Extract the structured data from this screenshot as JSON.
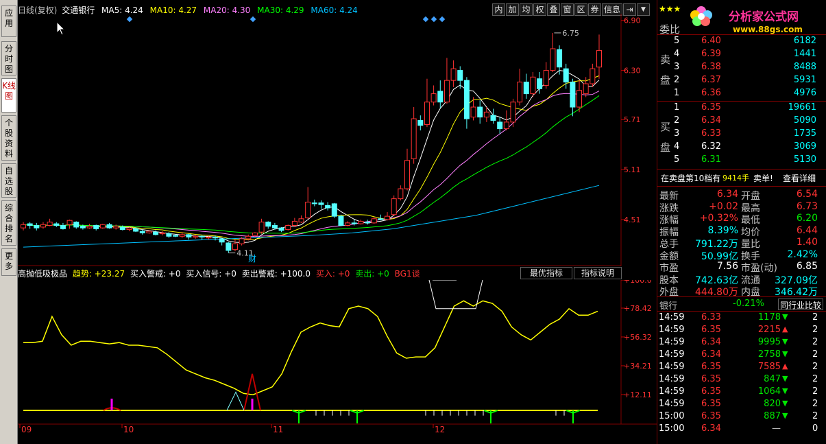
{
  "left_tabs": [
    {
      "label": "应用",
      "active": false
    },
    {
      "label": "分时图",
      "active": false
    },
    {
      "label": "K线图",
      "active": true
    },
    {
      "label": "个股资料",
      "active": false
    },
    {
      "label": "自选股",
      "active": false
    },
    {
      "label": "综合排名",
      "active": false
    },
    {
      "label": "更多",
      "active": false
    }
  ],
  "kline": {
    "period": "日线(复权)",
    "stock_name": "交通银行",
    "ma5": "MA5: 4.24",
    "ma10": "MA10: 4.27",
    "ma20": "MA20: 4.30",
    "ma30": "MA30: 4.29",
    "ma60": "MA60: 4.24",
    "price_axis": [
      "6.90",
      "6.30",
      "5.71",
      "5.11",
      "4.51"
    ],
    "high_label": "6.75",
    "low_label": "4.11",
    "event_marker": "财",
    "colors": {
      "ma5": "#ffffff",
      "ma10": "#ffff00",
      "ma20": "#ff80ff",
      "ma30": "#00ff00",
      "ma60": "#00c0ff",
      "up": "#ff3232",
      "down": "#54ffff"
    }
  },
  "top_menu": [
    "内",
    "加",
    "均",
    "权",
    "叠",
    "窗",
    "区",
    "券",
    "信息"
  ],
  "indicator": {
    "name": "高抛低吸极品",
    "trend": "趋势: +23.27",
    "buy_warn": "买入警戒: +0",
    "buy_signal": "买入信号: +0",
    "sell_warn": "卖出警戒: +100.0",
    "buy": "买入: +0",
    "sell": "卖出: +0",
    "bg": "BG1谈",
    "best_button": "最优指标",
    "help_button": "指标说明",
    "axis": [
      "+100.0",
      "+78.42",
      "+56.32",
      "+34.21",
      "+12.11"
    ]
  },
  "date_axis": [
    "09",
    "10",
    "11",
    "12"
  ],
  "watermark": {
    "title": "分析家公式网",
    "url": "www.88gs.com"
  },
  "order_book": {
    "header": "委比",
    "sell_label": [
      "卖",
      "盘"
    ],
    "buy_label": [
      "买",
      "盘"
    ],
    "sell": [
      {
        "level": "5",
        "price": "6.40",
        "vol": "6182"
      },
      {
        "level": "4",
        "price": "6.39",
        "vol": "1441"
      },
      {
        "level": "3",
        "price": "6.38",
        "vol": "8488"
      },
      {
        "level": "2",
        "price": "6.37",
        "vol": "5931"
      },
      {
        "level": "1",
        "price": "6.36",
        "vol": "4976"
      }
    ],
    "buy": [
      {
        "level": "1",
        "price": "6.35",
        "vol": "19661"
      },
      {
        "level": "2",
        "price": "6.34",
        "vol": "5090"
      },
      {
        "level": "3",
        "price": "6.33",
        "vol": "1735"
      },
      {
        "level": "4",
        "price": "6.32",
        "vol": "3069"
      },
      {
        "level": "5",
        "price": "6.31",
        "vol": "5130"
      }
    ]
  },
  "notice": {
    "text": "在卖盘第10档有",
    "qty": "9414手",
    "action": "卖单!",
    "detail": "查看详细"
  },
  "quote": [
    {
      "l1": "最新",
      "v1": "6.34",
      "c1": "red",
      "l2": "开盘",
      "v2": "6.54",
      "c2": "red"
    },
    {
      "l1": "涨跌",
      "v1": "+0.02",
      "c1": "red",
      "l2": "最高",
      "v2": "6.73",
      "c2": "red"
    },
    {
      "l1": "涨幅",
      "v1": "+0.32%",
      "c1": "red",
      "l2": "最低",
      "v2": "6.20",
      "c2": "green"
    },
    {
      "l1": "振幅",
      "v1": "8.39%",
      "c1": "cyan",
      "l2": "均价",
      "v2": "6.44",
      "c2": "red"
    },
    {
      "l1": "总手",
      "v1": "791.22万",
      "c1": "cyan",
      "l2": "量比",
      "v2": "1.40",
      "c2": "red"
    },
    {
      "l1": "金额",
      "v1": "50.99亿",
      "c1": "cyan",
      "l2": "换手",
      "v2": "2.42%",
      "c2": "cyan"
    },
    {
      "l1": "市盈",
      "v1": "7.56",
      "c1": "white",
      "l2": "市盈(动)",
      "v2": "6.85",
      "c2": "white"
    },
    {
      "l1": "股本",
      "v1": "742.63亿",
      "c1": "cyan",
      "l2": "流通",
      "v2": "327.09亿",
      "c2": "cyan"
    },
    {
      "l1": "外盘",
      "v1": "444.80万",
      "c1": "red",
      "l2": "内盘",
      "v2": "346.42万",
      "c2": "cyan"
    }
  ],
  "industry": {
    "name": "银行",
    "change": "-0.21%",
    "compare": "同行业比较"
  },
  "ticks": [
    {
      "time": "14:59",
      "price": "6.33",
      "vol": "1178",
      "dir": "down",
      "n": "2"
    },
    {
      "time": "14:59",
      "price": "6.35",
      "vol": "2215",
      "dir": "up",
      "n": "2"
    },
    {
      "time": "14:59",
      "price": "6.34",
      "vol": "9995",
      "dir": "down",
      "n": "2"
    },
    {
      "time": "14:59",
      "price": "6.34",
      "vol": "2758",
      "dir": "down",
      "n": "2"
    },
    {
      "time": "14:59",
      "price": "6.35",
      "vol": "7585",
      "dir": "up",
      "n": "2"
    },
    {
      "time": "14:59",
      "price": "6.35",
      "vol": "847",
      "dir": "down",
      "n": "2"
    },
    {
      "time": "14:59",
      "price": "6.35",
      "vol": "1064",
      "dir": "down",
      "n": "2"
    },
    {
      "time": "14:59",
      "price": "6.35",
      "vol": "820",
      "dir": "down",
      "n": "2"
    },
    {
      "time": "15:00",
      "price": "6.35",
      "vol": "887",
      "dir": "down",
      "n": "2"
    },
    {
      "time": "15:00",
      "price": "6.34",
      "vol": "—",
      "dir": "none",
      "n": "0"
    }
  ]
}
